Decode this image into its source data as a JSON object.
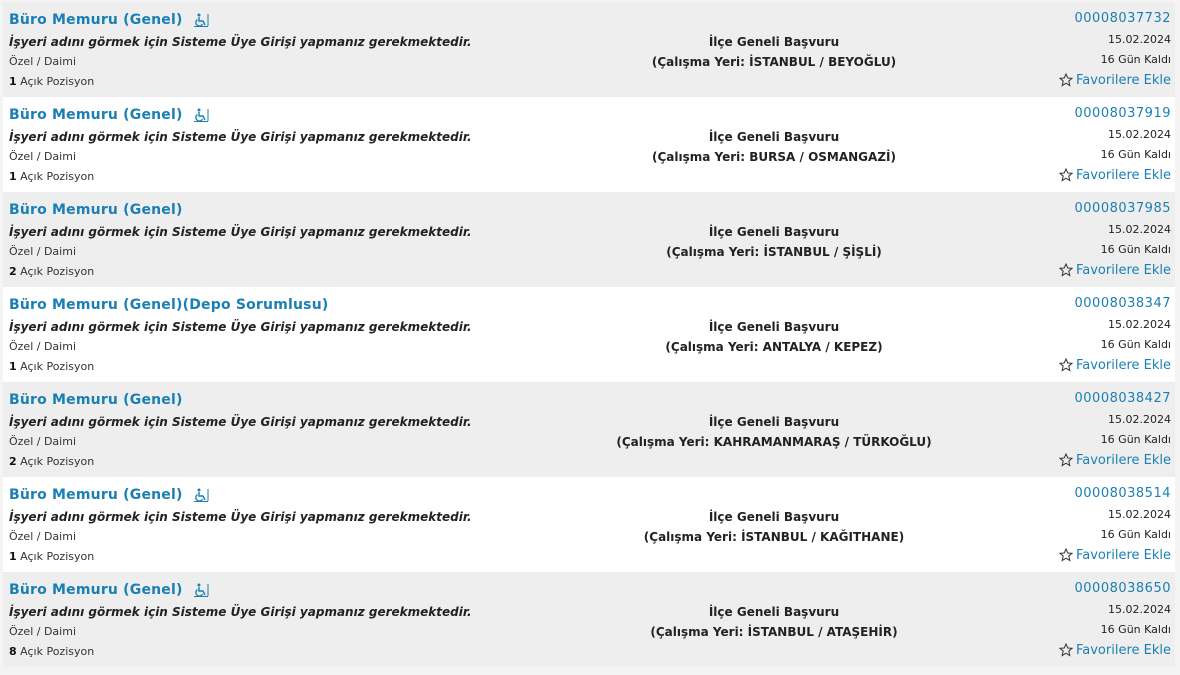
{
  "listings": [
    {
      "title": "Büro Memuru (Genel)",
      "accessible": true,
      "employer_note": "İşyeri adını görmek için Sisteme Üye Girişi yapmanız gerekmektedir.",
      "type": "Özel / Daimi",
      "positions_count": "1",
      "positions_label": "Açık Pozisyon",
      "application_scope": "İlçe Geneli Başvuru",
      "workplace": "(Çalışma Yeri: İSTANBUL / BEYOĞLU)",
      "reference": "00008037732",
      "date": "15.02.2024",
      "days_left": "16 Gün Kaldı",
      "favorite_label": "Favorilere Ekle"
    },
    {
      "title": "Büro Memuru (Genel)",
      "accessible": true,
      "employer_note": "İşyeri adını görmek için Sisteme Üye Girişi yapmanız gerekmektedir.",
      "type": "Özel / Daimi",
      "positions_count": "1",
      "positions_label": "Açık Pozisyon",
      "application_scope": "İlçe Geneli Başvuru",
      "workplace": "(Çalışma Yeri: BURSA / OSMANGAZİ)",
      "reference": "00008037919",
      "date": "15.02.2024",
      "days_left": "16 Gün Kaldı",
      "favorite_label": "Favorilere Ekle"
    },
    {
      "title": "Büro Memuru (Genel)",
      "accessible": false,
      "employer_note": "İşyeri adını görmek için Sisteme Üye Girişi yapmanız gerekmektedir.",
      "type": "Özel / Daimi",
      "positions_count": "2",
      "positions_label": "Açık Pozisyon",
      "application_scope": "İlçe Geneli Başvuru",
      "workplace": "(Çalışma Yeri: İSTANBUL / ŞİŞLİ)",
      "reference": "00008037985",
      "date": "15.02.2024",
      "days_left": "16 Gün Kaldı",
      "favorite_label": "Favorilere Ekle"
    },
    {
      "title": "Büro Memuru (Genel)(Depo Sorumlusu)",
      "accessible": false,
      "employer_note": "İşyeri adını görmek için Sisteme Üye Girişi yapmanız gerekmektedir.",
      "type": "Özel / Daimi",
      "positions_count": "1",
      "positions_label": "Açık Pozisyon",
      "application_scope": "İlçe Geneli Başvuru",
      "workplace": "(Çalışma Yeri: ANTALYA / KEPEZ)",
      "reference": "00008038347",
      "date": "15.02.2024",
      "days_left": "16 Gün Kaldı",
      "favorite_label": "Favorilere Ekle"
    },
    {
      "title": "Büro Memuru (Genel)",
      "accessible": false,
      "employer_note": "İşyeri adını görmek için Sisteme Üye Girişi yapmanız gerekmektedir.",
      "type": "Özel / Daimi",
      "positions_count": "2",
      "positions_label": "Açık Pozisyon",
      "application_scope": "İlçe Geneli Başvuru",
      "workplace": "(Çalışma Yeri: KAHRAMANMARAŞ / TÜRKOĞLU)",
      "reference": "00008038427",
      "date": "15.02.2024",
      "days_left": "16 Gün Kaldı",
      "favorite_label": "Favorilere Ekle"
    },
    {
      "title": "Büro Memuru (Genel)",
      "accessible": true,
      "employer_note": "İşyeri adını görmek için Sisteme Üye Girişi yapmanız gerekmektedir.",
      "type": "Özel / Daimi",
      "positions_count": "1",
      "positions_label": "Açık Pozisyon",
      "application_scope": "İlçe Geneli Başvuru",
      "workplace": "(Çalışma Yeri: İSTANBUL / KAĞITHANE)",
      "reference": "00008038514",
      "date": "15.02.2024",
      "days_left": "16 Gün Kaldı",
      "favorite_label": "Favorilere Ekle"
    },
    {
      "title": "Büro Memuru (Genel)",
      "accessible": true,
      "employer_note": "İşyeri adını görmek için Sisteme Üye Girişi yapmanız gerekmektedir.",
      "type": "Özel / Daimi",
      "positions_count": "8",
      "positions_label": "Açık Pozisyon",
      "application_scope": "İlçe Geneli Başvuru",
      "workplace": "(Çalışma Yeri: İSTANBUL / ATAŞEHİR)",
      "reference": "00008038650",
      "date": "15.02.2024",
      "days_left": "16 Gün Kaldı",
      "favorite_label": "Favorilere Ekle"
    }
  ],
  "colors": {
    "link": "#1a7fb5",
    "row_shade": "#eeeeee",
    "row_plain": "#ffffff"
  },
  "icons": {
    "accessible": "wheelchair-icon",
    "favorite": "star-outline-icon"
  }
}
